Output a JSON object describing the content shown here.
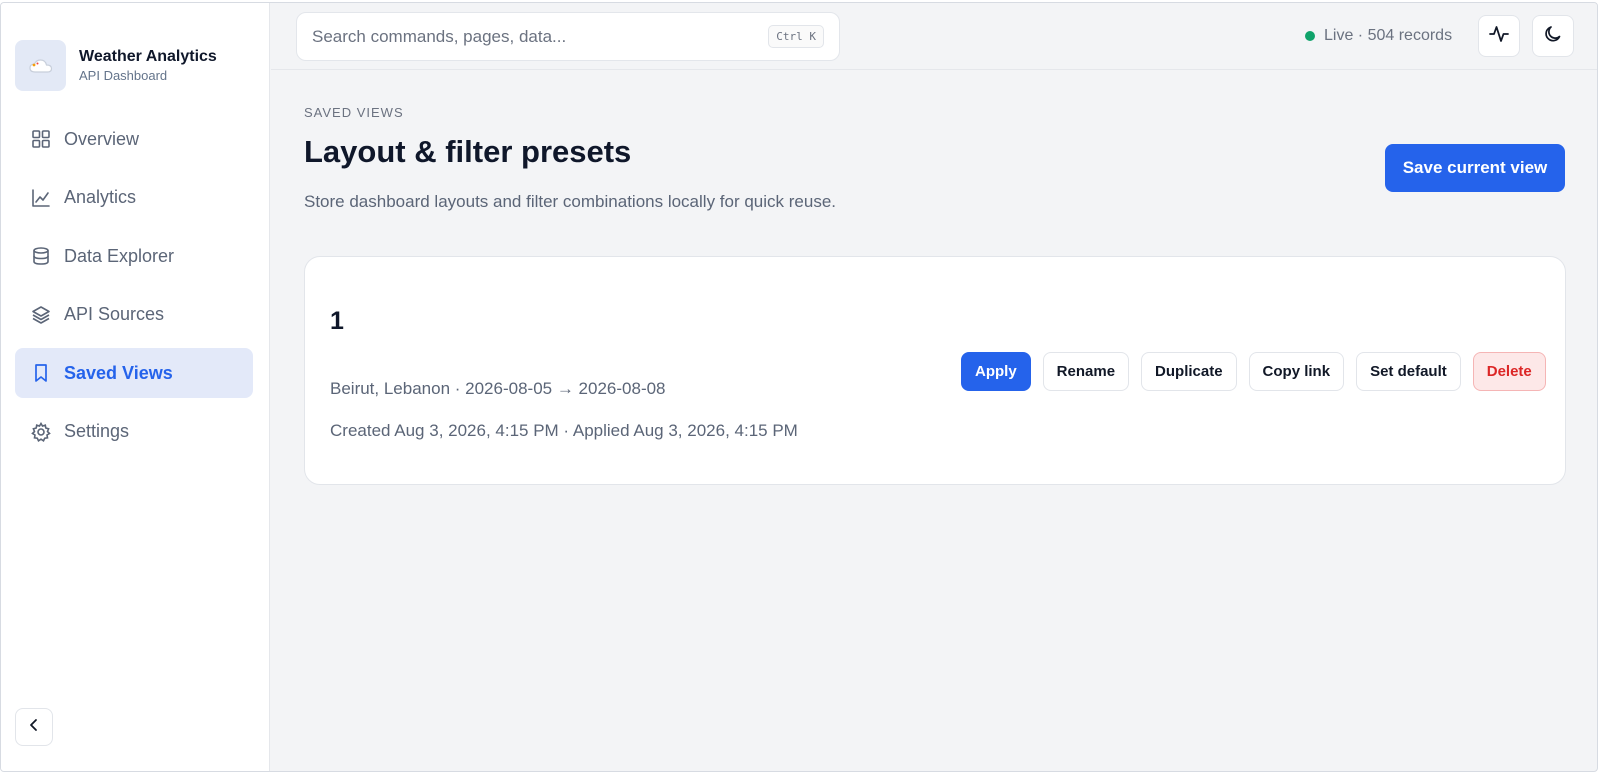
{
  "app": {
    "title": "Weather Analytics",
    "subtitle": "API Dashboard"
  },
  "sidebar": {
    "items": [
      {
        "label": "Overview",
        "icon": "grid-icon",
        "active": false
      },
      {
        "label": "Analytics",
        "icon": "line-chart-icon",
        "active": false
      },
      {
        "label": "Data Explorer",
        "icon": "database-icon",
        "active": false
      },
      {
        "label": "API Sources",
        "icon": "layers-icon",
        "active": false
      },
      {
        "label": "Saved Views",
        "icon": "bookmark-icon",
        "active": true
      },
      {
        "label": "Settings",
        "icon": "gear-icon",
        "active": false
      }
    ],
    "collapse_icon": "chevron-left-icon"
  },
  "topbar": {
    "search_placeholder": "Search commands, pages, data...",
    "shortcut": "Ctrl K",
    "status_text": "Live · 504 records",
    "status_color": "#10a36b",
    "activity_icon": "activity-icon",
    "theme_icon": "moon-icon"
  },
  "page": {
    "eyebrow": "SAVED VIEWS",
    "title": "Layout & filter presets",
    "description": "Store dashboard layouts and filter combinations locally for quick reuse.",
    "save_button": "Save current view"
  },
  "views": [
    {
      "name": "1",
      "filters": "Beirut, Lebanon · 2026-08-05 → 2026-08-08",
      "timestamps": "Created Aug 3, 2026, 4:15 PM · Applied Aug 3, 2026, 4:15 PM",
      "actions": {
        "apply": "Apply",
        "rename": "Rename",
        "duplicate": "Duplicate",
        "copy_link": "Copy link",
        "set_default": "Set default",
        "delete": "Delete"
      }
    }
  ],
  "colors": {
    "accent": "#2563eb",
    "danger": "#dc2626"
  }
}
